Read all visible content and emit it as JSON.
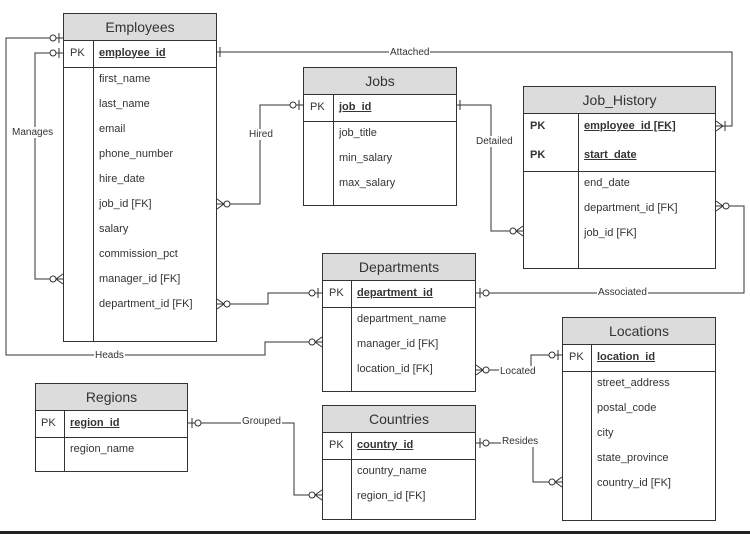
{
  "entities": [
    {
      "name": "Employees",
      "keys": [
        {
          "label": "PK",
          "field": "employee_id"
        }
      ],
      "fields": [
        "first_name",
        "last_name",
        "email",
        "phone_number",
        "hire_date",
        "job_id [FK]",
        "salary",
        "commission_pct",
        "manager_id [FK]",
        "department_id [FK]"
      ]
    },
    {
      "name": "Jobs",
      "keys": [
        {
          "label": "PK",
          "field": "job_id"
        }
      ],
      "fields": [
        "job_title",
        "min_salary",
        "max_salary"
      ]
    },
    {
      "name": "Job_History",
      "keys": [
        {
          "label": "PK",
          "field": "employee_id [FK]"
        },
        {
          "label": "PK",
          "field": "start_date"
        }
      ],
      "fields": [
        "end_date",
        "department_id [FK]",
        "job_id [FK]"
      ]
    },
    {
      "name": "Departments",
      "keys": [
        {
          "label": "PK",
          "field": "department_id"
        }
      ],
      "fields": [
        "department_name",
        "manager_id [FK]",
        "location_id [FK]"
      ]
    },
    {
      "name": "Locations",
      "keys": [
        {
          "label": "PK",
          "field": "location_id"
        }
      ],
      "fields": [
        "street_address",
        "postal_code",
        "city",
        "state_province",
        "country_id [FK]"
      ]
    },
    {
      "name": "Regions",
      "keys": [
        {
          "label": "PK",
          "field": "region_id"
        }
      ],
      "fields": [
        "region_name"
      ]
    },
    {
      "name": "Countries",
      "keys": [
        {
          "label": "PK",
          "field": "country_id"
        }
      ],
      "fields": [
        "country_name",
        "region_id [FK]"
      ]
    }
  ],
  "relationships": [
    {
      "label": "Manages",
      "from": "Employees.employee_id",
      "to": "Employees.manager_id [FK]",
      "cardinality": "zero-or-one to zero-or-many"
    },
    {
      "label": "Heads",
      "from": "Employees",
      "to": "Departments.manager_id [FK]",
      "cardinality": "zero-or-one to zero-or-many"
    },
    {
      "label": "Attached",
      "from": "Employees.employee_id",
      "to": "Job_History.employee_id [FK]",
      "cardinality": "one to one-or-many"
    },
    {
      "label": "Hired",
      "from": "Jobs.job_id",
      "to": "Employees.job_id [FK]",
      "cardinality": "zero-or-one to zero-or-many"
    },
    {
      "label": "Detailed",
      "from": "Jobs.job_id",
      "to": "Job_History.job_id [FK]",
      "cardinality": "one to zero-or-many"
    },
    {
      "label": "Associated",
      "from": "Departments.department_id",
      "to": "Job_History.department_id [FK]",
      "cardinality": "zero-or-one to zero-or-many"
    },
    {
      "label": "",
      "from": "Departments.department_id",
      "to": "Employees.department_id [FK]",
      "cardinality": "zero-or-one to zero-or-many"
    },
    {
      "label": "Located",
      "from": "Locations.location_id",
      "to": "Departments.location_id [FK]",
      "cardinality": "zero-or-one to zero-or-many"
    },
    {
      "label": "Grouped",
      "from": "Regions.region_id",
      "to": "Countries.region_id [FK]",
      "cardinality": "zero-or-one to zero-or-many"
    },
    {
      "label": "Resides",
      "from": "Countries.country_id",
      "to": "Locations.country_id [FK]",
      "cardinality": "zero-or-one to zero-or-many"
    }
  ],
  "colors": {
    "header": "#dcdcdc",
    "line": "#333333"
  }
}
